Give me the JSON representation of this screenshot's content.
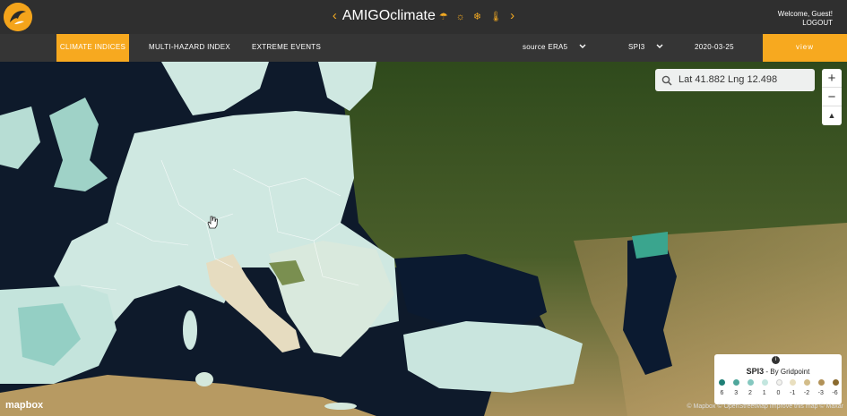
{
  "header": {
    "app_name": "AMIGOclimate",
    "prev_arrow": "‹",
    "next_arrow": "›",
    "weather_icons": "☂ ☼ ❄ 🌡",
    "welcome": "Welcome, Guest!",
    "logout": "LOGOUT"
  },
  "nav": {
    "tabs": [
      "CLIMATE INDICES",
      "MULTI-HAZARD INDEX",
      "EXTREME EVENTS"
    ],
    "active_tab": "CLIMATE INDICES",
    "source_label": "source ERA5",
    "index_label": "SPI3",
    "date": "2020-03-25",
    "view_label": "view"
  },
  "map": {
    "search_value": "Lat 41.882 Lng 12.498",
    "zoom_in": "+",
    "zoom_out": "−",
    "compass": "▲",
    "logo_text": "mapbox",
    "attribution": "© Mapbox © OpenStreetMap Improve this map © Maxar"
  },
  "legend": {
    "title": "SPI3",
    "subtitle": "- By Gridpoint",
    "info": "i",
    "values": [
      "6",
      "3",
      "2",
      "1",
      "0",
      "-1",
      "-2",
      "-3",
      "-6"
    ],
    "colors": [
      "#1f7f76",
      "#4fa79c",
      "#85c8c0",
      "#c3e6df",
      "#f2f2ee",
      "#e9dfbf",
      "#d3bd89",
      "#b29258",
      "#8a6a2e"
    ]
  },
  "colors": {
    "accent": "#f7a91f",
    "sea": "#0e1a2b",
    "spi_wet": "#cfe8e1",
    "spi_very_wet": "#8ccbc0",
    "spi_dry": "#e6dcc0"
  }
}
